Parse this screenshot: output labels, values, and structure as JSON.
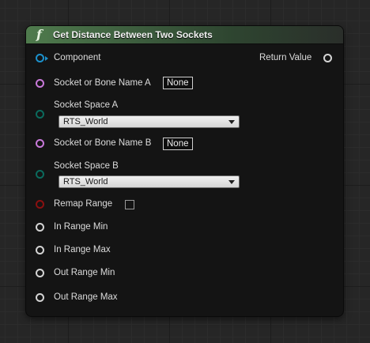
{
  "node": {
    "icon": "function-icon",
    "title": "Get Distance Between Two Sockets",
    "inputs": {
      "component": "Component",
      "socket_a": "Socket or Bone Name A",
      "socket_a_value": "None",
      "space_a": "Socket Space A",
      "space_a_value": "RTS_World",
      "socket_b": "Socket or Bone Name B",
      "socket_b_value": "None",
      "space_b": "Socket Space B",
      "space_b_value": "RTS_World",
      "remap_range": "Remap Range",
      "in_range_min": "In Range Min",
      "in_range_max": "In Range Max",
      "out_range_min": "Out Range Min",
      "out_range_max": "Out Range Max"
    },
    "outputs": {
      "return_value": "Return Value"
    }
  },
  "colors": {
    "header_green": "#4f7b4d",
    "object_pin": "#1c91cc",
    "name_pin": "#c879d9",
    "enum_pin": "#0b6a5d",
    "bool_pin": "#8a1010",
    "float_pin": "#d4d4d4"
  }
}
